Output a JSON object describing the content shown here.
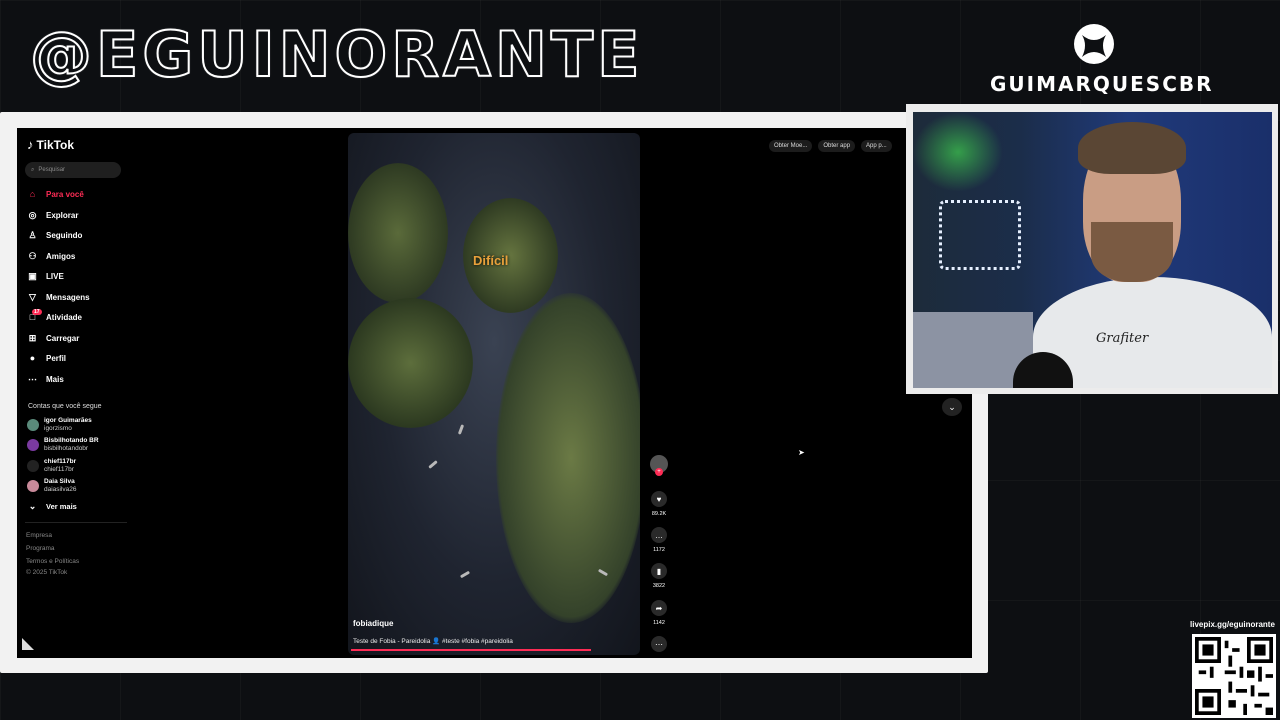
{
  "overlay": {
    "channel_handle": "@EGUINORANTE",
    "gamertag": "GUIMARQUESCBR",
    "livepix": "livepix.gg/eguinorante"
  },
  "tiktok": {
    "logo": "TikTok",
    "search_placeholder": "Pesquisar",
    "nav": [
      {
        "label": "Para você",
        "icon": "home-icon"
      },
      {
        "label": "Explorar",
        "icon": "compass-icon"
      },
      {
        "label": "Seguindo",
        "icon": "following-icon"
      },
      {
        "label": "Amigos",
        "icon": "friends-icon"
      },
      {
        "label": "LIVE",
        "icon": "live-icon"
      },
      {
        "label": "Mensagens",
        "icon": "messages-icon"
      },
      {
        "label": "Atividade",
        "icon": "activity-icon",
        "badge": "17"
      },
      {
        "label": "Carregar",
        "icon": "upload-icon"
      },
      {
        "label": "Perfil",
        "icon": "profile-icon"
      },
      {
        "label": "Mais",
        "icon": "more-icon"
      }
    ],
    "following_title": "Contas que você segue",
    "following": [
      {
        "name": "igor Guimarães",
        "handle": "igorzismo"
      },
      {
        "name": "Bisbilhotando BR",
        "handle": "bisbilhotandobr"
      },
      {
        "name": "chief117br",
        "handle": "chief117br"
      },
      {
        "name": "Daia Silva",
        "handle": "daiasilva26"
      }
    ],
    "see_more": "Ver mais",
    "footer": [
      "Empresa",
      "Programa",
      "Termos e Políticas",
      "© 2025 TikTok"
    ],
    "topbar": {
      "coins": "Obter Moe...",
      "get_app": "Obter app",
      "pc_app": "App p..."
    },
    "video": {
      "overlay_text": "Difícil",
      "author": "fobiadique",
      "description": "Teste de Fobia - Pareidolia 👤 #teste #fobia #pareidolia",
      "likes": "89.2K",
      "comments": "1172",
      "saves": "3822",
      "shares": "1142"
    }
  },
  "webcam": {
    "shirt_text": "Grafiter"
  },
  "colors": {
    "accent": "#fe2c55",
    "overlay_text": "#e8a13b"
  }
}
